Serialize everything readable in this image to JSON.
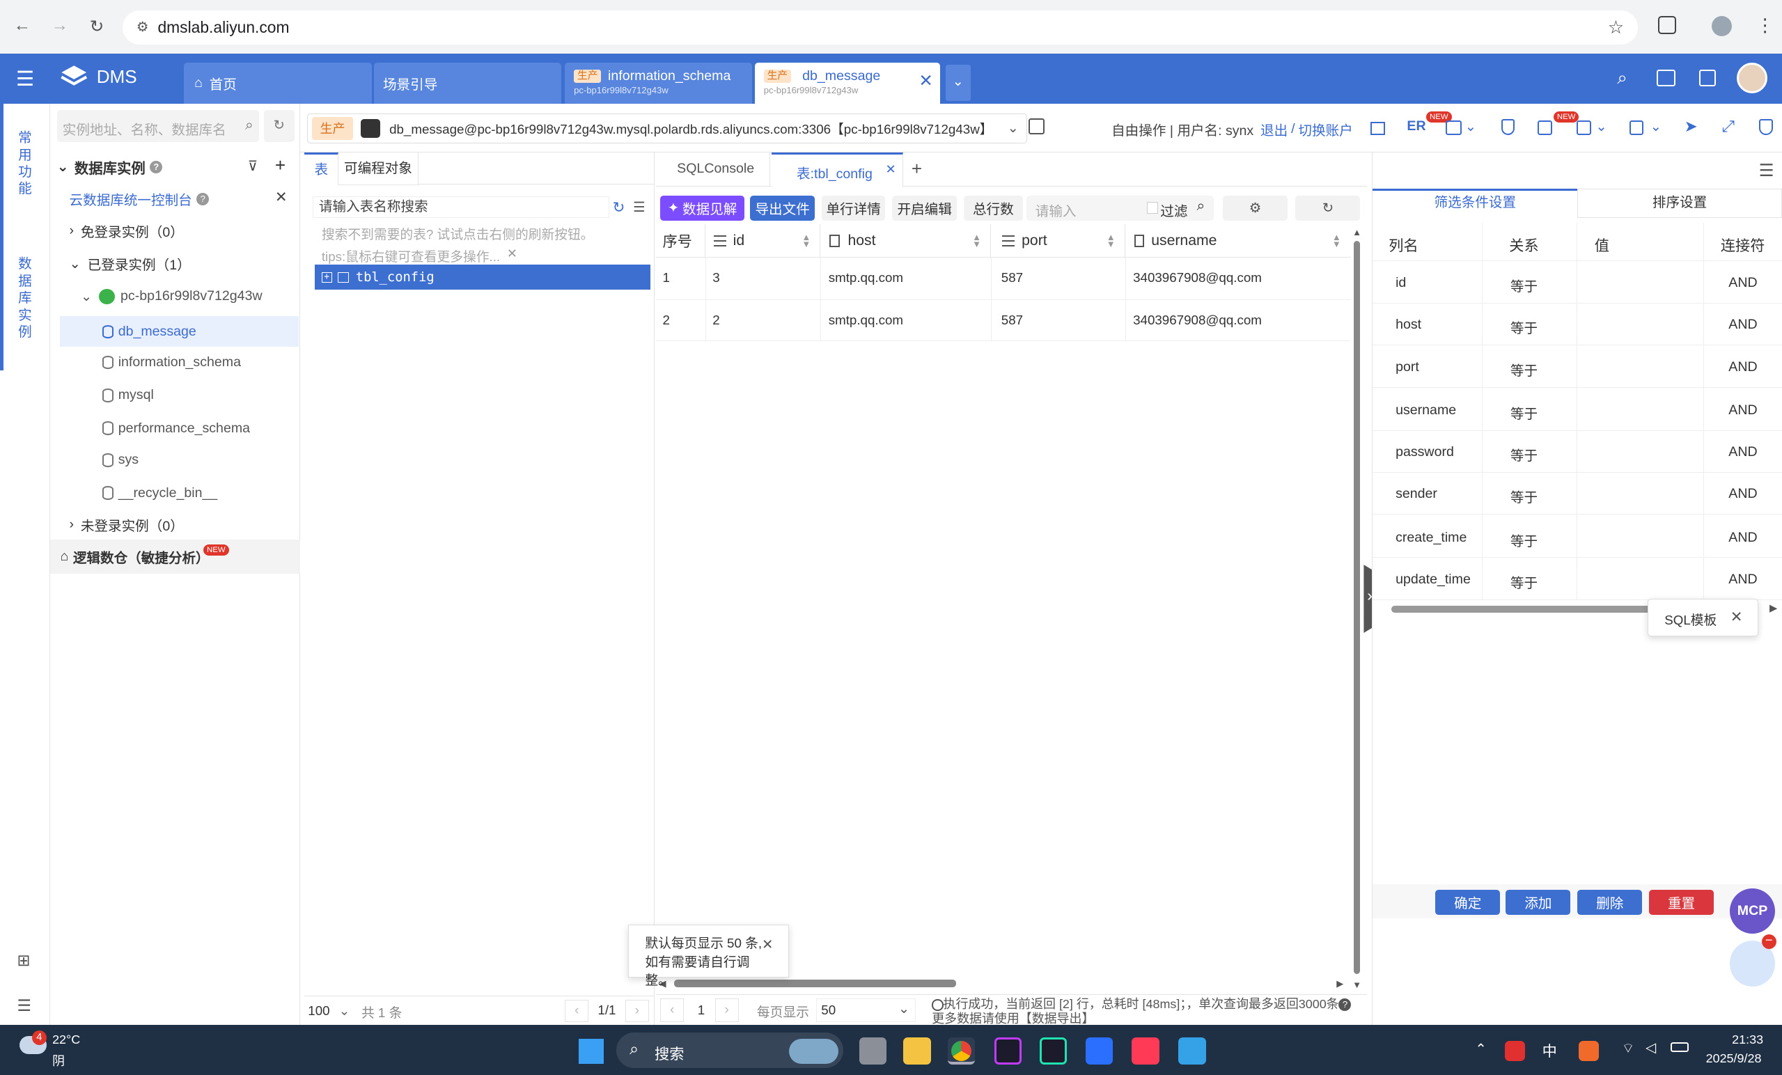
{
  "browser": {
    "url": "dmslab.aliyun.com"
  },
  "app": {
    "name": "DMS"
  },
  "tabs": [
    {
      "label": "首页"
    },
    {
      "label": "场景引导"
    },
    {
      "badge": "生产",
      "label": "information_schema",
      "sub": "pc-bp16r99l8v712g43w"
    },
    {
      "badge": "生产",
      "label": "db_message",
      "sub": "pc-bp16r99l8v712g43w"
    }
  ],
  "left_rail": {
    "common": "常用功能",
    "db_instance": "数据库实例"
  },
  "tree": {
    "search_placeholder": "实例地址、名称、数据库名",
    "section": "数据库实例",
    "console_link": "云数据库统一控制台",
    "free_login": "免登录实例（0）",
    "logged_in": "已登录实例（1）",
    "instance": "pc-bp16r99l8v712g43w",
    "databases": [
      "db_message",
      "information_schema",
      "mysql",
      "performance_schema",
      "sys",
      "__recycle_bin__"
    ],
    "not_logged": "未登录实例（0）",
    "logical": "逻辑数仓（敏捷分析）",
    "new_badge": "NEW"
  },
  "topbar": {
    "env": "生产",
    "connection": "db_message@pc-bp16r99l8v712g43w.mysql.polardb.rds.aliyuncs.com:3306【pc-bp16r99l8v712g43w】",
    "mode": "自由操作 | 用户名: synx",
    "logout": "退出",
    "switch": "切换账户",
    "er": "ER",
    "new_badge": "NEW"
  },
  "tables_panel": {
    "tab_table": "表",
    "tab_programmable": "可编程对象",
    "search_placeholder": "请输入表名称搜索",
    "hint": "搜索不到需要的表? 试试点击右侧的刷新按钮。",
    "tips": "tips:鼠标右键可查看更多操作...",
    "table_name": "tbl_config",
    "page_size": "100",
    "total": "共 1 条",
    "pager": "1/1"
  },
  "sql": {
    "tab_console": "SQLConsole",
    "tab_table": "表:tbl_config",
    "buttons": {
      "insight": "数据见解",
      "export": "导出文件",
      "detail": "单行详情",
      "edit": "开启编辑",
      "rows": "总行数"
    },
    "filter_placeholder": "请输入",
    "filter_label": "过滤",
    "columns": [
      "序号",
      "id",
      "host",
      "port",
      "username"
    ],
    "rows": [
      [
        "1",
        "3",
        "smtp.qq.com",
        "587",
        "3403967908@qq.com"
      ],
      [
        "2",
        "2",
        "smtp.qq.com",
        "587",
        "3403967908@qq.com"
      ]
    ],
    "page_num": "1",
    "per_page_label": "每页显示",
    "per_page": "50",
    "status": "执行成功，当前返回 [2] 行，总耗时 [48ms]；，单次查询最多返回3000条",
    "status2": "更多数据请使用【数据导出】",
    "tooltip_line1": "默认每页显示 50 条,",
    "tooltip_line2": "如有需要请自行调整。"
  },
  "filter_panel": {
    "tab_filter": "筛选条件设置",
    "tab_sort": "排序设置",
    "headers": [
      "列名",
      "关系",
      "值",
      "连接符"
    ],
    "rows": [
      {
        "col": "id",
        "rel": "等于",
        "conn": "AND"
      },
      {
        "col": "host",
        "rel": "等于",
        "conn": "AND"
      },
      {
        "col": "port",
        "rel": "等于",
        "conn": "AND"
      },
      {
        "col": "username",
        "rel": "等于",
        "conn": "AND"
      },
      {
        "col": "password",
        "rel": "等于",
        "conn": "AND"
      },
      {
        "col": "sender",
        "rel": "等于",
        "conn": "AND"
      },
      {
        "col": "create_time",
        "rel": "等于",
        "conn": "AND"
      },
      {
        "col": "update_time",
        "rel": "等于",
        "conn": "AND"
      }
    ],
    "sql_template": "SQL模板",
    "buttons": {
      "confirm": "确定",
      "add": "添加",
      "delete": "删除",
      "reset": "重置"
    },
    "mcp": "MCP"
  },
  "taskbar": {
    "temp": "22°C",
    "weather": "阴",
    "weather_badge": "4",
    "search": "搜索",
    "ime": "中",
    "time": "21:33",
    "date": "2025/9/28"
  },
  "colors": {
    "primary": "#3d6fd1",
    "insight": "#7c4dff",
    "reset": "#d9363e"
  }
}
